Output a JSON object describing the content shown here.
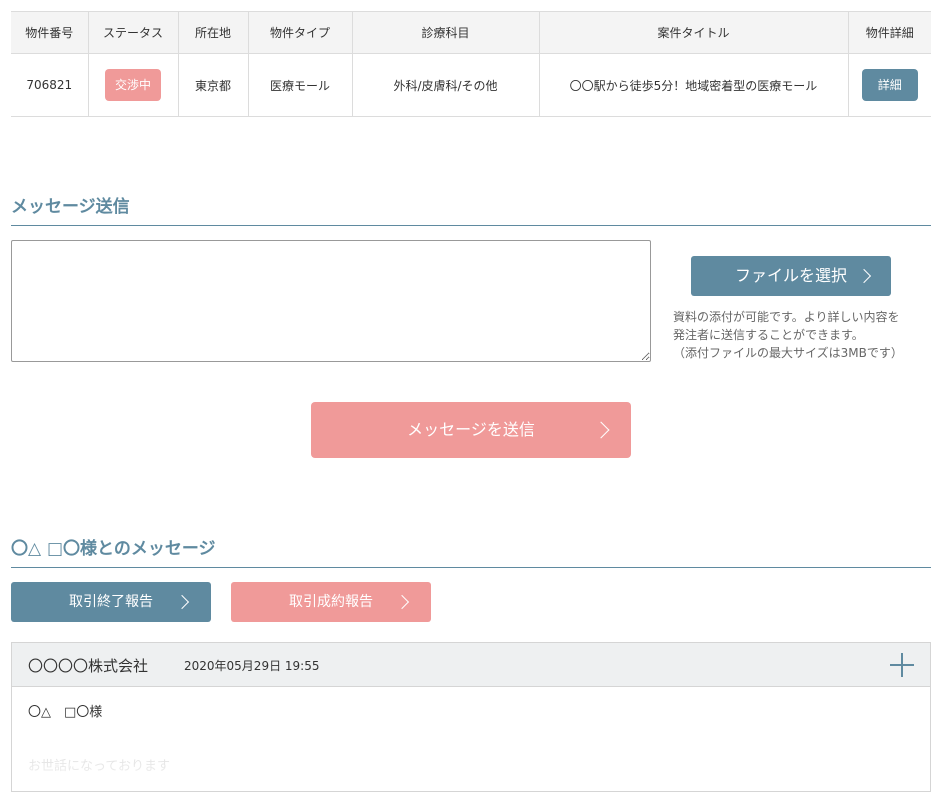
{
  "table": {
    "headers": [
      "物件番号",
      "ステータス",
      "所在地",
      "物件タイプ",
      "診療科目",
      "案件タイトル",
      "物件詳細"
    ],
    "row": {
      "number": "706821",
      "status": "交渉中",
      "location": "東京都",
      "type": "医療モール",
      "departments": "外科/皮膚科/その他",
      "title": "〇〇駅から徒歩5分！地域密着型の医療モール",
      "detail_label": "詳細"
    }
  },
  "send_section": {
    "heading": "メッセージ送信",
    "textarea_value": "",
    "file_button_label": "ファイルを選択",
    "file_note": [
      "資料の添付が可能です。より詳しい内容を",
      "発注者に送信することができます。",
      "（添付ファイルの最大サイズは3MBです）"
    ],
    "send_button_label": "メッセージを送信"
  },
  "conversation": {
    "heading": "〇△ □〇様とのメッセージ",
    "end_report_label": "取引終了報告",
    "deal_report_label": "取引成約報告",
    "message": {
      "company": "〇〇〇〇株式会社",
      "date": "2020年05月29日 19:55",
      "greeting": "〇△　□〇様",
      "faded_text": "お世話になっております"
    }
  },
  "colors": {
    "accent_blue": "#5f8aa0",
    "accent_pink": "#f09a99"
  }
}
